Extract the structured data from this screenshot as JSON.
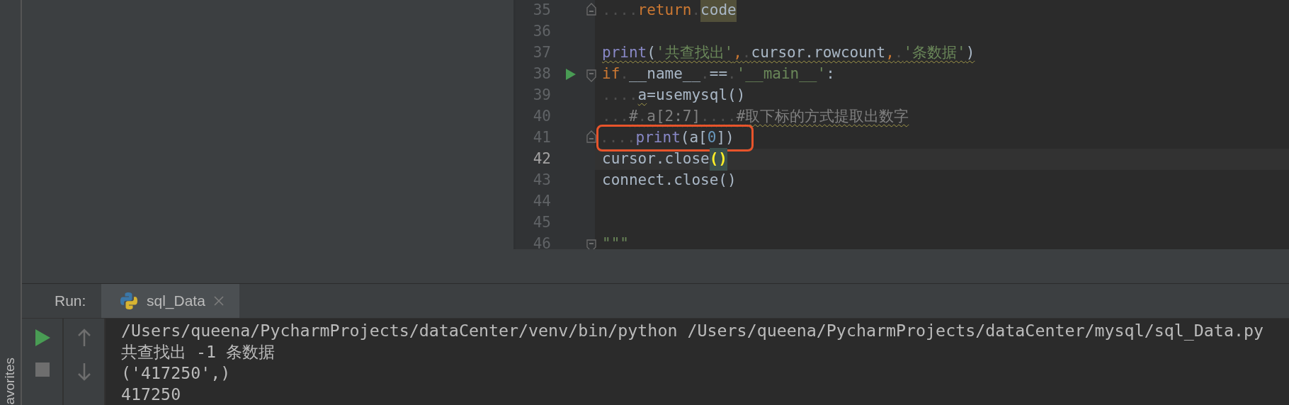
{
  "favorites_label": "avorites",
  "editor": {
    "lines": [
      {
        "number": "35",
        "fold_end": true,
        "tokens": [
          {
            "kind": "whitespace",
            "text": "...."
          },
          {
            "kind": "keyword",
            "text": "return"
          },
          {
            "kind": "whitespace",
            "text": "."
          },
          {
            "kind": "usage",
            "text": "code"
          }
        ]
      },
      {
        "number": "36"
      },
      {
        "number": "37",
        "tokens": [
          {
            "kind": "builtin",
            "text": "print",
            "warning": true
          },
          {
            "kind": "plain",
            "text": "(",
            "warning": true
          },
          {
            "kind": "string",
            "text": "'共查找出'",
            "warning": true
          },
          {
            "kind": "keyword",
            "text": ",",
            "warning": true
          },
          {
            "kind": "whitespace",
            "text": ".",
            "warning": true
          },
          {
            "kind": "plain",
            "text": "cursor.rowcount",
            "warning": true
          },
          {
            "kind": "keyword",
            "text": ",",
            "warning": true
          },
          {
            "kind": "whitespace",
            "text": ".",
            "warning": true
          },
          {
            "kind": "string",
            "text": "'条数据'",
            "warning": true
          },
          {
            "kind": "plain",
            "text": ")",
            "warning": true
          }
        ]
      },
      {
        "number": "38",
        "run_marker": true,
        "fold_start": true,
        "tokens": [
          {
            "kind": "keyword",
            "text": "if"
          },
          {
            "kind": "whitespace",
            "text": "."
          },
          {
            "kind": "plain",
            "text": "__name__"
          },
          {
            "kind": "whitespace",
            "text": "."
          },
          {
            "kind": "plain",
            "text": "=="
          },
          {
            "kind": "whitespace",
            "text": "."
          },
          {
            "kind": "string",
            "text": "'__main__'"
          },
          {
            "kind": "plain",
            "text": ":"
          }
        ]
      },
      {
        "number": "39",
        "tokens": [
          {
            "kind": "whitespace",
            "text": "...."
          },
          {
            "kind": "plain",
            "text": "a",
            "warning": true
          },
          {
            "kind": "plain",
            "text": "=usemysql()"
          }
        ]
      },
      {
        "number": "40",
        "tokens": [
          {
            "kind": "whitespace",
            "text": "..."
          },
          {
            "kind": "comment",
            "text": "#",
            "warning": true
          },
          {
            "kind": "whitespace",
            "text": ".",
            "warning": true
          },
          {
            "kind": "comment",
            "text": "a[2:7]",
            "warning": true
          },
          {
            "kind": "whitespace",
            "text": "....",
            "warning": true
          },
          {
            "kind": "comment",
            "text": "#取下标的方式提取出数字",
            "warning": true
          }
        ]
      },
      {
        "number": "41",
        "fold_end": true,
        "boxed": true,
        "tokens": [
          {
            "kind": "whitespace",
            "text": "...."
          },
          {
            "kind": "builtin",
            "text": "print"
          },
          {
            "kind": "plain",
            "text": "(a["
          },
          {
            "kind": "number",
            "text": "0"
          },
          {
            "kind": "plain",
            "text": "])"
          }
        ]
      },
      {
        "number": "42",
        "current": true,
        "tokens": [
          {
            "kind": "plain",
            "text": "cursor.close"
          },
          {
            "kind": "brace",
            "text": "()"
          }
        ]
      },
      {
        "number": "43",
        "tokens": [
          {
            "kind": "plain",
            "text": "connect.close()"
          }
        ]
      },
      {
        "number": "44"
      },
      {
        "number": "45"
      },
      {
        "number": "46",
        "fold_start": true,
        "tokens": [
          {
            "kind": "string",
            "text": "\"\"\""
          }
        ]
      }
    ]
  },
  "run_panel": {
    "label": "Run:",
    "tabs": [
      {
        "label": "sql_Data",
        "selected": true
      }
    ],
    "console": [
      "/Users/queena/PycharmProjects/dataCenter/venv/bin/python /Users/queena/PycharmProjects/dataCenter/mysql/sql_Data.py",
      "共查找出 -1 条数据",
      "('417250',)",
      "417250"
    ]
  }
}
